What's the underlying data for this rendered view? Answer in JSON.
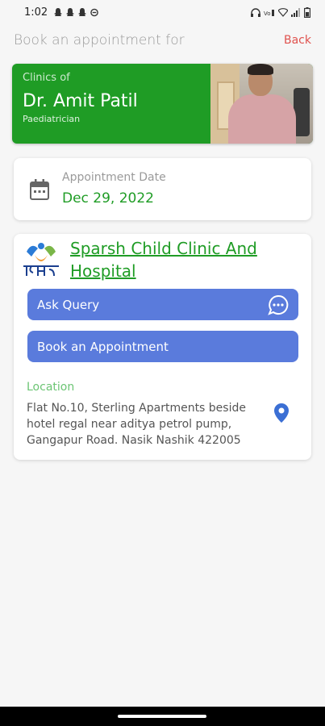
{
  "status_bar": {
    "time": "1:02",
    "notification_icons": [
      "snapchat-icon",
      "snapchat-icon",
      "snapchat-icon",
      "circle-icon"
    ],
    "system_icons": [
      "headphones-icon",
      "volte-icon",
      "wifi-icon",
      "signal-icon",
      "battery-icon"
    ]
  },
  "header": {
    "title": "Book an appointment for",
    "back_label": "Back"
  },
  "doctor": {
    "caption": "Clinics of",
    "name": "Dr. Amit Patil",
    "specialty": "Paediatrician"
  },
  "appointment": {
    "label": "Appointment Date",
    "date": "Dec 29, 2022"
  },
  "clinic": {
    "name": "Sparsh Child Clinic And Hospital",
    "ask_query_label": "Ask Query",
    "book_label": "Book an Appointment",
    "location_label": "Location",
    "address": "Flat No.10, Sterling Apartments beside hotel regal near aditya petrol pump, Gangapur Road. Nasik Nashik 422005"
  },
  "colors": {
    "brand_green": "#1f9c25",
    "button_blue": "#5a7bdc",
    "back_red": "#e0524e"
  }
}
